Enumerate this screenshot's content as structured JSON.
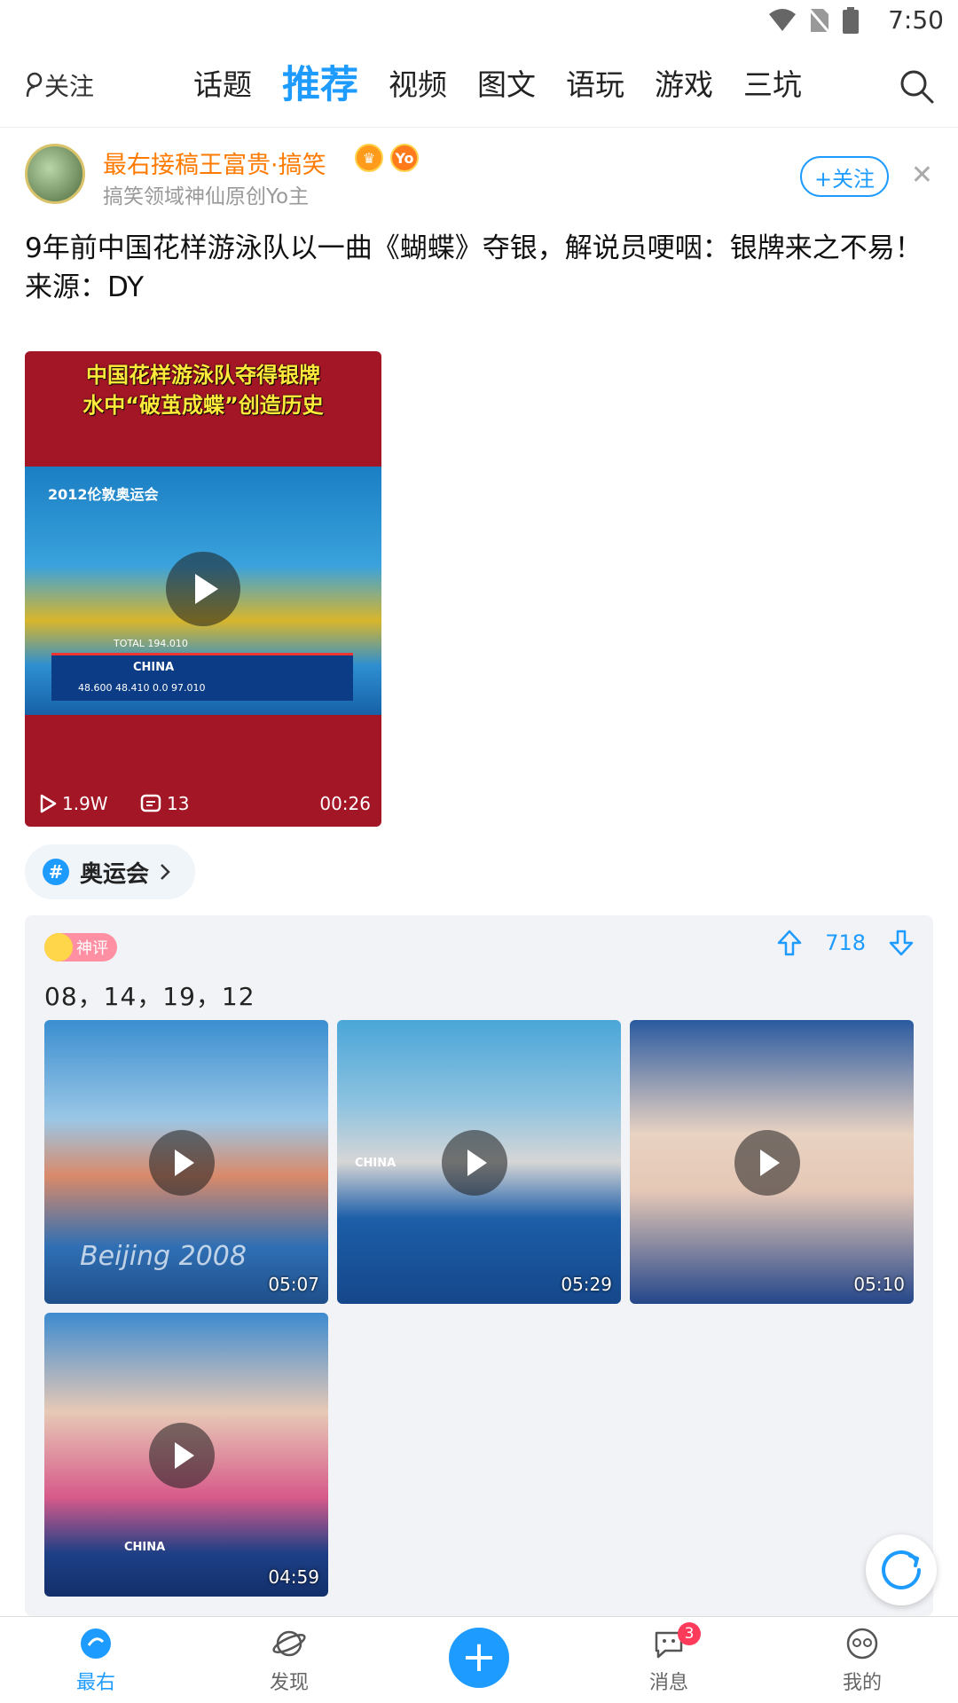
{
  "status_bar": {
    "time": "7:50"
  },
  "top_nav": {
    "follow_label": "关注",
    "tabs": [
      {
        "label": "话题",
        "active": false
      },
      {
        "label": "推荐",
        "active": true
      },
      {
        "label": "视频",
        "active": false
      },
      {
        "label": "图文",
        "active": false
      },
      {
        "label": "语玩",
        "active": false
      },
      {
        "label": "游戏",
        "active": false
      },
      {
        "label": "三坑",
        "active": false
      }
    ]
  },
  "post": {
    "author_name": "最右接稿王富贵·搞笑",
    "author_badge_yo": "Yo",
    "author_sub": "搞笑领域神仙原创Yo主",
    "follow_button": "+关注",
    "text_line1": "9年前中国花样游泳队以一曲《蝴蝶》夺银，解说员哽咽：银牌来之不易！",
    "text_line2": "来源：DY",
    "video": {
      "overlay_title_1": "中国花样游泳队夺得银牌",
      "overlay_title_2": "水中“破茧成蝶”创造历史",
      "event_label": "2012伦敦奥运会",
      "score_country": "CHINA",
      "score_total": "TOTAL 194.010",
      "score_values": "48.600   48.410   0.0   97.010",
      "plays": "1.9W",
      "comments": "13",
      "duration": "00:26"
    },
    "topic": "奥运会"
  },
  "comment": {
    "tag": "神评",
    "likes": "718",
    "text": "08，14，19，12",
    "videos": [
      {
        "duration": "05:07",
        "caption": "Beijing 2008"
      },
      {
        "duration": "05:29",
        "caption": "CHINA"
      },
      {
        "duration": "05:10",
        "caption": ""
      },
      {
        "duration": "04:59",
        "caption": "CHINA"
      }
    ]
  },
  "bottom_nav": {
    "items": [
      {
        "label": "最右",
        "active": true
      },
      {
        "label": "发现",
        "active": false
      },
      {
        "label": "消息",
        "active": false,
        "badge": "3"
      },
      {
        "label": "我的",
        "active": false
      }
    ]
  },
  "colors": {
    "accent": "#1e9bff",
    "author": "#ff7a00",
    "badge": "#ff3b5c"
  }
}
